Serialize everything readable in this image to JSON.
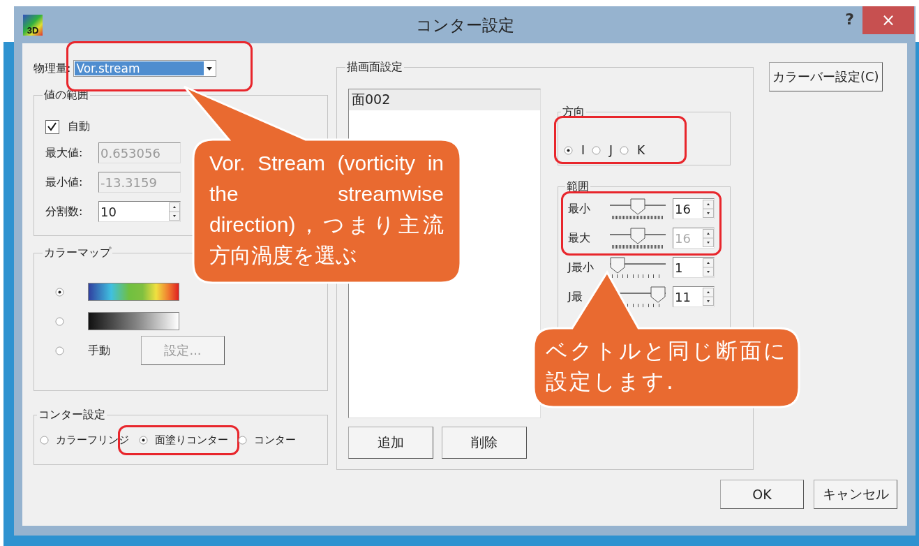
{
  "window": {
    "icon_label": "3D",
    "title": "コンター設定",
    "help": "?",
    "close": "×"
  },
  "quantity": {
    "label": "物理量:",
    "value": "Vor.stream",
    "highlighted": true
  },
  "value_range": {
    "title": "値の範囲",
    "auto": {
      "label": "自動",
      "checked": true
    },
    "fields": [
      {
        "kind": "text",
        "label": "最大値:",
        "value": "0.653056",
        "disabled": true
      },
      {
        "kind": "text",
        "label": "最小値:",
        "value": "-13.3159",
        "disabled": true
      },
      {
        "kind": "spin",
        "label": "分割数:",
        "value": "10",
        "disabled": false
      }
    ]
  },
  "colormap": {
    "title": "カラーマップ",
    "options": [
      {
        "kind": "rainbow",
        "selected": true
      },
      {
        "kind": "grayscale",
        "selected": false
      },
      {
        "kind": "manual",
        "label": "手動",
        "button": "設定...",
        "button_disabled": true,
        "selected": false
      }
    ]
  },
  "contour": {
    "title": "コンター設定",
    "options": [
      {
        "label": "カラーフリンジ",
        "selected": false,
        "highlighted": false
      },
      {
        "label": "面塗りコンター",
        "selected": true,
        "highlighted": true
      },
      {
        "label": "コンター",
        "selected": false,
        "highlighted": false
      }
    ]
  },
  "drawing_plane": {
    "title": "描画面設定",
    "list": [
      {
        "label": "面002",
        "selected": true
      }
    ],
    "buttons": [
      "追加",
      "削除"
    ],
    "direction": {
      "title": "方向",
      "highlighted": true,
      "options": [
        {
          "label": "I",
          "selected": true
        },
        {
          "label": "J",
          "selected": false
        },
        {
          "label": "K",
          "selected": false
        }
      ]
    },
    "range": {
      "title": "範囲",
      "rows": [
        {
          "kind": "fine",
          "label": "最小",
          "level": 0.5,
          "value": "16",
          "disabled": false,
          "highlighted": true
        },
        {
          "kind": "fine",
          "label": "最大",
          "level": 0.5,
          "value": "16",
          "disabled": true,
          "highlighted": true
        },
        {
          "kind": "coarse",
          "label": "J最小",
          "level": 0,
          "value": "1",
          "disabled": false,
          "highlighted": false
        },
        {
          "kind": "coarse",
          "label": "J最",
          "level": 1,
          "value": "11",
          "disabled": false,
          "highlighted": false
        }
      ]
    }
  },
  "colorbar_button": "カラーバー設定(C)",
  "footer_buttons": [
    "OK",
    "キャンセル"
  ],
  "callouts": [
    {
      "text": "Vor. Stream (vorticity in the streamwise direction)，つまり主流方向渦度を選ぶ"
    },
    {
      "text": "ベクトルと同じ断面に設定します."
    }
  ]
}
